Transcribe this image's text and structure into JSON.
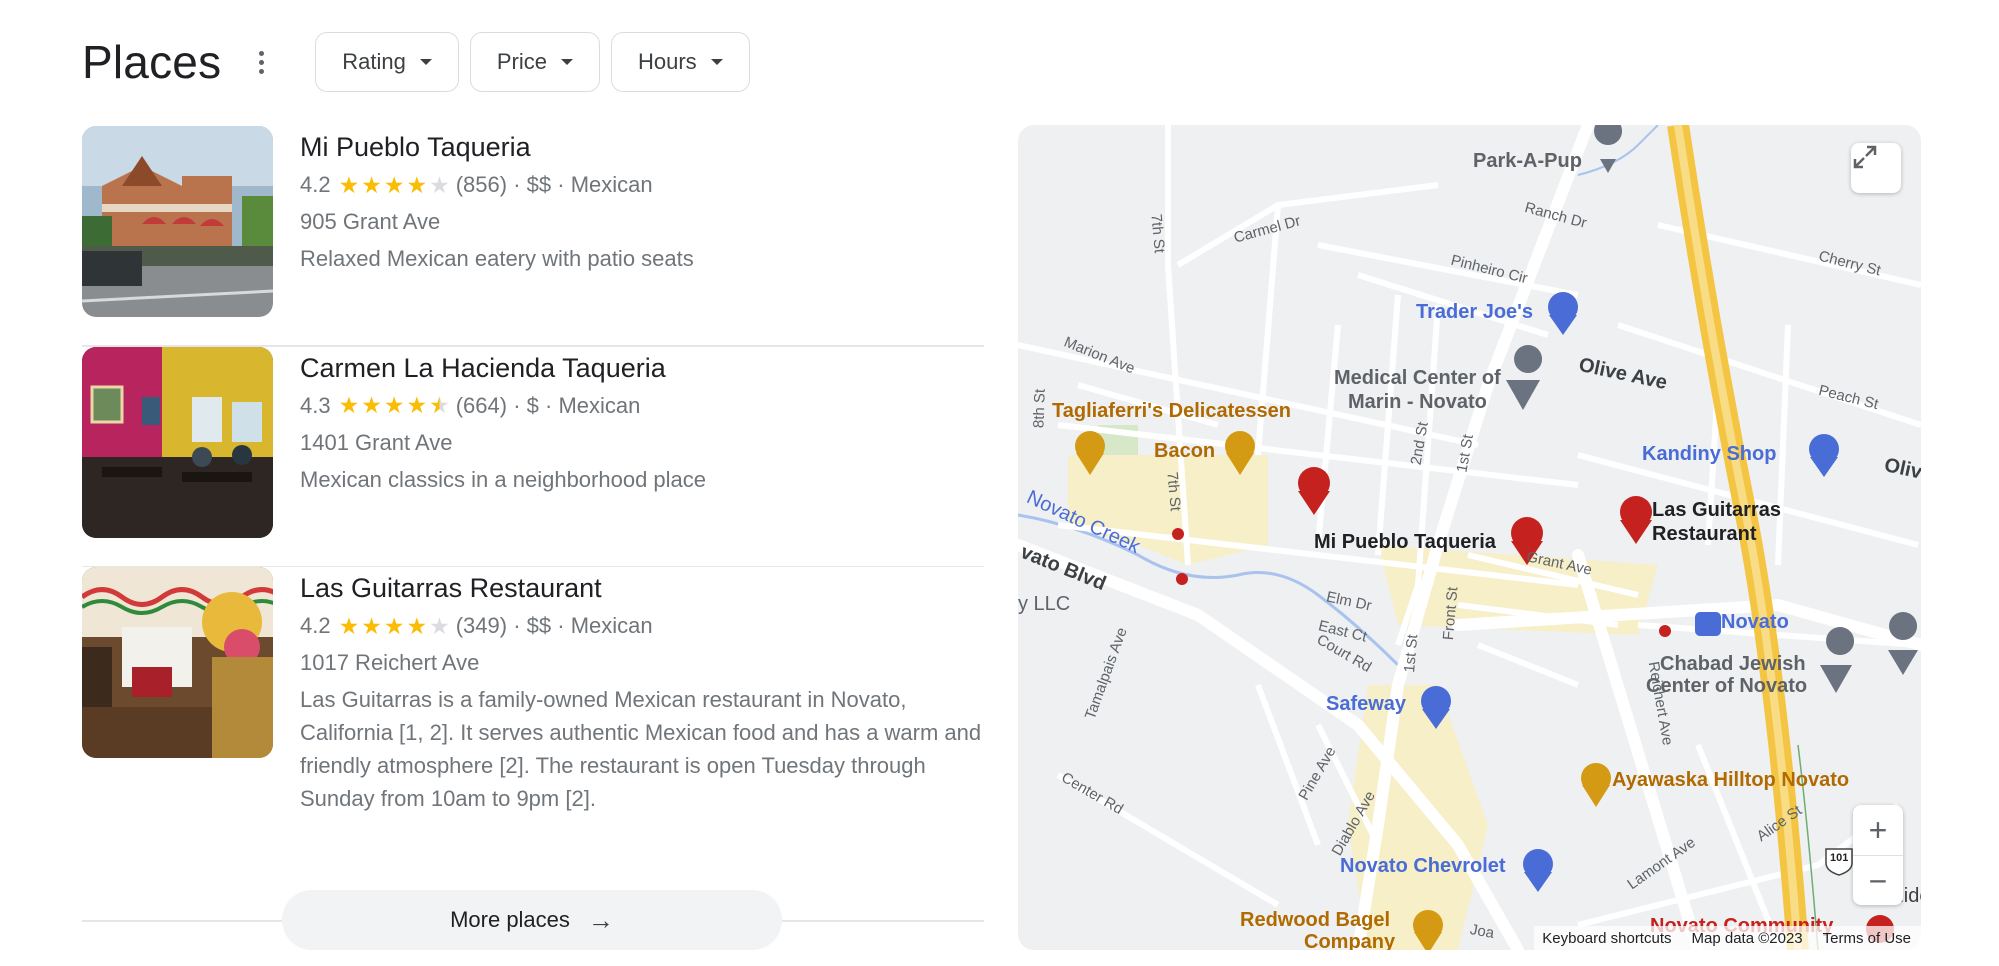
{
  "header": {
    "title": "Places",
    "filters": [
      {
        "label": "Rating"
      },
      {
        "label": "Price"
      },
      {
        "label": "Hours"
      }
    ]
  },
  "places": [
    {
      "name": "Mi Pueblo Taqueria",
      "rating": "4.2",
      "rating_value": 4.2,
      "reviews": "(856)",
      "price": "$$",
      "category": "Mexican",
      "address": "905 Grant Ave",
      "description": "Relaxed Mexican eatery with patio seats"
    },
    {
      "name": "Carmen La Hacienda Taqueria",
      "rating": "4.3",
      "rating_value": 4.3,
      "reviews": "(664)",
      "price": "$",
      "category": "Mexican",
      "address": "1401 Grant Ave",
      "description": "Mexican classics in a neighborhood place"
    },
    {
      "name": "Las Guitarras Restaurant",
      "rating": "4.2",
      "rating_value": 4.2,
      "reviews": "(349)",
      "price": "$$",
      "category": "Mexican",
      "address": "1017 Reichert Ave",
      "description": "Las Guitarras is a family-owned Mexican restaurant in Novato, California [1, 2]. It serves authentic Mexican food and has a warm and friendly atmosphere [2]. The restaurant is open Tuesday through Sunday from 10am to 9pm [2]."
    }
  ],
  "more_button": {
    "label": "More places"
  },
  "map": {
    "labels": {
      "park_a_pup": "Park-A-Pup",
      "trader_joes": "Trader Joe's",
      "medical_center_1": "Medical Center of",
      "medical_center_2": "Marin - Novato",
      "olive_ave": "Olive Ave",
      "tagliaferris": "Tagliaferri's Delicatessen",
      "bacon": "Bacon",
      "kandiny_shop": "Kandiny Shop",
      "mi_pueblo": "Mi Pueblo Taqueria",
      "las_guitarras_1": "Las Guitarras",
      "las_guitarras_2": "Restaurant",
      "novato_creek": "Novato Creek",
      "novato_blvd": "vato Blvd",
      "llc": "y LLC",
      "novato_station": "Novato",
      "chabad_1": "Chabad Jewish",
      "chabad_2": "Center of Novato",
      "safeway": "Safeway",
      "ayawaska": "Ayawaska Hilltop Novato",
      "novato_chevrolet": "Novato Chevrolet",
      "redwood_bagel_1": "Redwood Bagel",
      "redwood_bagel_2": "Company",
      "novato_community": "Novato Community",
      "olive_edge": "Olive",
      "slide_edge": "Slide R",
      "grant_ave": "Grant Ave",
      "carmel_dr": "Carmel Dr",
      "ranch_dr": "Ranch Dr",
      "pinheiro_cir": "Pinheiro Cir",
      "cherry_st": "Cherry St",
      "peach_st": "Peach St",
      "marion_ave": "Marion Ave",
      "seventh_st_top": "7th St",
      "seventh_st": "7th St",
      "eighth_st": "8th St",
      "second_st": "2nd St",
      "first_st": "1st St",
      "first_st_2": "1st St",
      "front_st": "Front St",
      "elm_dr": "Elm Dr",
      "east_ct": "East Ct",
      "court_rd": "Court Rd",
      "tamalpais_ave": "Tamalpais Ave",
      "reichert_ave": "Reichert Ave",
      "center_rd": "Center Rd",
      "pine_ave": "Pine Ave",
      "diablo_ave": "Diablo Ave",
      "lamont_ave": "Lamont Ave",
      "alice_st": "Alice St",
      "joan_ave": "Joa",
      "shield_101": "101"
    },
    "zoom_in": "+",
    "zoom_out": "−",
    "attribution": {
      "shortcuts": "Keyboard shortcuts",
      "data": "Map data ©2023",
      "terms": "Terms of Use"
    }
  }
}
